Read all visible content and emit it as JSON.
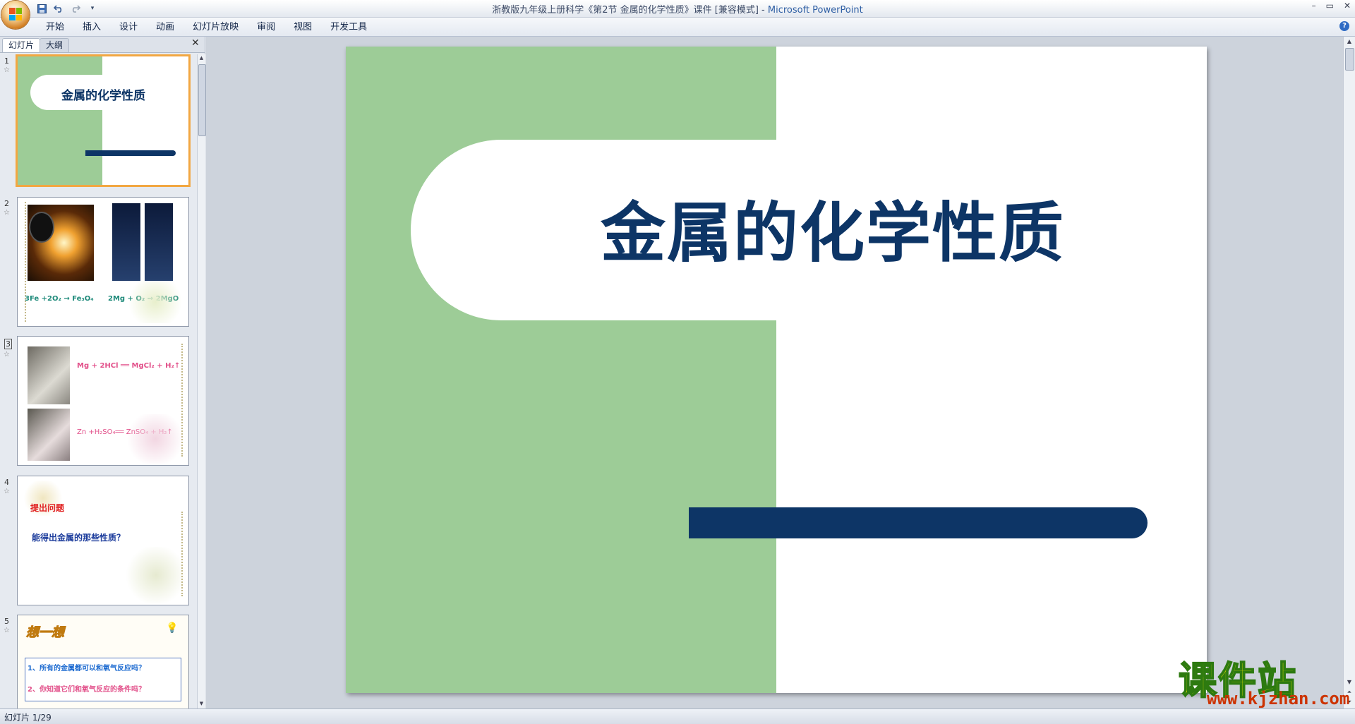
{
  "window": {
    "title_main": "浙教版九年级上册科学《第2节 金属的化学性质》课件 [兼容模式] - ",
    "title_app": "Microsoft PowerPoint",
    "minimize": "–",
    "restore": "▭",
    "close": "✕"
  },
  "ribbon": {
    "tabs": [
      "开始",
      "插入",
      "设计",
      "动画",
      "幻灯片放映",
      "审阅",
      "视图",
      "开发工具"
    ],
    "help": "?"
  },
  "panel": {
    "tab_slides": "幻灯片",
    "tab_outline": "大纲",
    "close": "✕"
  },
  "thumbnails": [
    {
      "num": "1",
      "title": "金属的化学性质"
    },
    {
      "num": "2",
      "eq1": "3Fe +2O₂ → Fe₃O₄",
      "eq2": "2Mg + O₂ → 2MgO"
    },
    {
      "num": "3",
      "eq1": "Mg + 2HCl ══ MgCl₂ + H₂↑",
      "eq2": "Zn +H₂SO₄══ ZnSO₄ + H₂↑"
    },
    {
      "num": "4",
      "heading": "提出问题",
      "question": "能得出金属的那些性质？"
    },
    {
      "num": "5",
      "heading": "想一想",
      "q1": "1、所有的金属都可以和氧气反应吗？",
      "q2": "2、你知道它们和氧气反应的条件吗？"
    }
  ],
  "slide": {
    "title": "金属的化学性质"
  },
  "status": {
    "text": "幻灯片 1/29"
  },
  "watermark": {
    "main": "课件站",
    "url": "www.kjzhan.com"
  },
  "colors": {
    "slide_green": "#9dcc97",
    "slide_navy": "#0d3566",
    "selection_orange": "#f2a742"
  }
}
